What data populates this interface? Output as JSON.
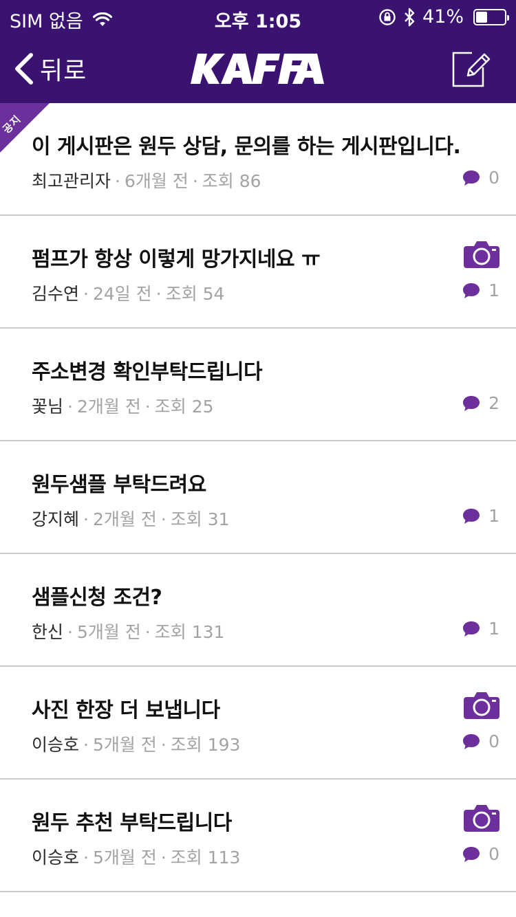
{
  "status_bar": {
    "carrier": "SIM 없음",
    "time": "오후 1:05",
    "battery_percent_label": "41%",
    "battery_level": 0.41
  },
  "nav": {
    "back_label": "뒤로",
    "logo_text": "KAFFA"
  },
  "colors": {
    "brand_purple": "#3a1270",
    "accent_purple": "#6d2f9c"
  },
  "posts": [
    {
      "notice_label": "공지",
      "title": "이 게시판은 원두 상담, 문의를 하는 게시판입니다.",
      "author": "최고관리자",
      "age": "6개월 전",
      "views": "조회 86",
      "comments": "0",
      "has_photo": false
    },
    {
      "title": "펌프가 항상 이렇게 망가지네요 ㅠ",
      "author": "김수연",
      "age": "24일 전",
      "views": "조회 54",
      "comments": "1",
      "has_photo": true
    },
    {
      "title": "주소변경 확인부탁드립니다",
      "author": "꽃님",
      "age": "2개월 전",
      "views": "조회 25",
      "comments": "2",
      "has_photo": false
    },
    {
      "title": "원두샘플 부탁드려요",
      "author": "강지혜",
      "age": "2개월 전",
      "views": "조회 31",
      "comments": "1",
      "has_photo": false
    },
    {
      "title": "샘플신청 조건?",
      "author": "한신",
      "age": "5개월 전",
      "views": "조회 131",
      "comments": "1",
      "has_photo": false
    },
    {
      "title": "사진 한장 더 보냅니다",
      "author": "이승호",
      "age": "5개월 전",
      "views": "조회 193",
      "comments": "0",
      "has_photo": true
    },
    {
      "title": "원두 추천 부탁드립니다",
      "author": "이승호",
      "age": "5개월 전",
      "views": "조회 113",
      "comments": "0",
      "has_photo": true
    }
  ]
}
